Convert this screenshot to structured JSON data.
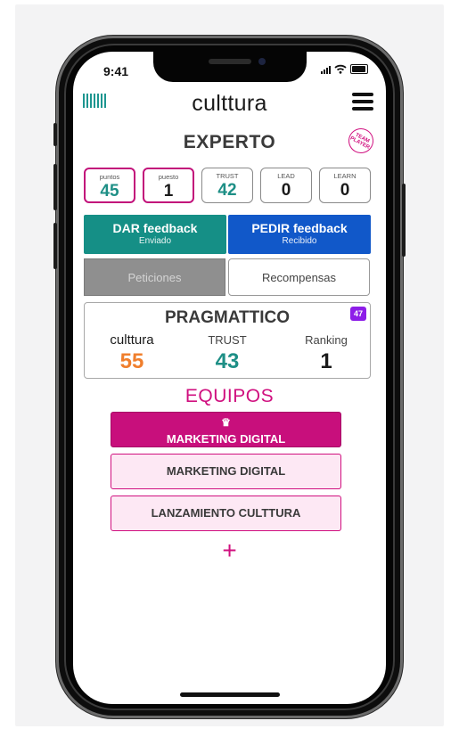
{
  "status_bar": {
    "time": "9:41"
  },
  "header": {
    "logo": "culttura",
    "barcode_icon": "barcode-icon",
    "menu_icon": "hamburger-menu-icon"
  },
  "level": {
    "title": "EXPERTO",
    "badge": "TEAM PLAYER"
  },
  "stats": [
    {
      "label": "puntos",
      "value": "45"
    },
    {
      "label": "puesto",
      "value": "1"
    },
    {
      "label": "TRUST",
      "value": "42"
    },
    {
      "label": "LEAD",
      "value": "0"
    },
    {
      "label": "LEARN",
      "value": "0"
    }
  ],
  "feedback": {
    "dar": {
      "title": "DAR feedback",
      "subtitle": "Enviado"
    },
    "pedir": {
      "title": "PEDIR feedback",
      "subtitle": "Recibido"
    }
  },
  "tabs": {
    "peticiones": "Peticiones",
    "recompensas": "Recompensas"
  },
  "team_card": {
    "name": "PRAGMATTICO",
    "badge": "47",
    "culttura_label": "culttura",
    "culttura_value": "55",
    "trust_label": "TRUST",
    "trust_value": "43",
    "ranking_label": "Ranking",
    "ranking_value": "1"
  },
  "equipos": {
    "title": "EQUIPOS",
    "teams": [
      "MARKETING DIGITAL",
      "MARKETING DIGITAL",
      "LANZAMIENTO CULTTURA"
    ],
    "add": "+"
  },
  "colors": {
    "teal": "#158f86",
    "blue": "#1158c9",
    "magenta": "#d0107f",
    "orange": "#f07f2d",
    "purple": "#8d1ee8"
  }
}
